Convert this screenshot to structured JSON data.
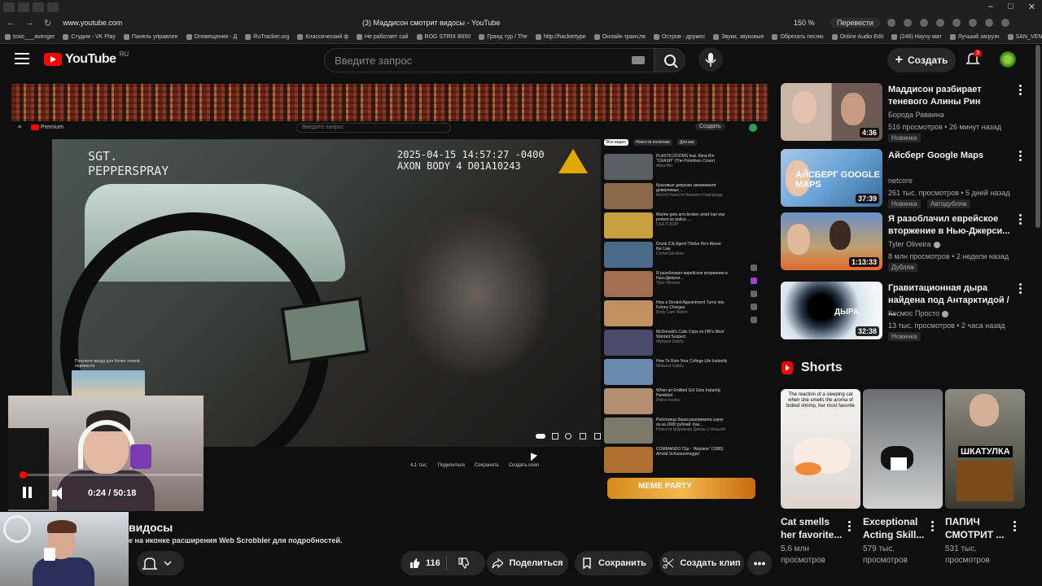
{
  "browser": {
    "tab_title": "(3) Маддисон смотрит видосы - YouTube",
    "url": "www.youtube.com",
    "zoom": "150 %",
    "translate": "Перевести",
    "bookmarks": [
      "toxic___avenger",
      "Студия - VK Play",
      "Панель управлен",
      "Оповещения - Д",
      "RuTracker.org",
      "Классический ф",
      "Не работает сай",
      "ROG STRIX B650",
      "Гранд тур / The",
      "http://hackertype",
      "Онлайн трансля",
      "Остров - дружес",
      "Звуки, звуковые",
      "Обрезать песню",
      "Online Audio Edit",
      "(246) Научу мат",
      "Лучший загрузч",
      "SAN_VENCI"
    ]
  },
  "header": {
    "logo_text": "YouTube",
    "region": "RU",
    "search_placeholder": "Введите запрос",
    "create_label": "Создать",
    "notification_count": "3"
  },
  "player": {
    "cam_tag": [
      "SGT.",
      "PEPPERSPRAY"
    ],
    "cam_timestamp": [
      "2025-04-15 14:57:27 -0400",
      "AXON BODY 4 D01A10243"
    ],
    "inner_premium": "Premium",
    "inner_search": "Введите запрос",
    "inner_create": "Создать",
    "inner_tabs": [
      "Все видео",
      "Новости политики",
      "Для вас"
    ],
    "inner_actions": [
      "4,1 тыс.",
      "Поделиться",
      "Сохранить",
      "Создать клип"
    ],
    "meme_party": "MEME PARTY",
    "pip_caption": "Получите ввода для более точной перевести",
    "time": "0:24 / 50:18",
    "progress": 0.008,
    "mini_videos": [
      {
        "title": "PLASTICZOOMS feat. Alina Rin \"CRASH\" (The Primitives Cover)",
        "meta": "Alina Rin"
      },
      {
        "title": "Красивые девушки заманивали доверчивых ...",
        "meta": "Вести Новости Нижнего Новгорода"
      },
      {
        "title": "Marine gets arm broken amid Iran war protest as police, ...",
        "meta": "USA TODAY"
      },
      {
        "title": "Drunk ICE Agent Thinks He's Above the Law",
        "meta": "CrimeCatchline"
      },
      {
        "title": "Я разоблачил еврейское вторжение в Нью-Джерси...",
        "meta": "Tyler Oliveira"
      },
      {
        "title": "How a Dentist Appointment Turns into Felony Charges",
        "meta": "Body Cam Watch"
      },
      {
        "title": "McDonald's Calls Cops on FBI's Most Wanted Suspect",
        "meta": "Midwest Safety"
      },
      {
        "title": "How To Ruin Your College Life Instantly",
        "meta": "Midwest Safety"
      },
      {
        "title": "When an Entitled Girl Gets Instantly Humbled",
        "meta": "Police Insider"
      },
      {
        "title": "Работница банка разгромила сауну из-за 2000 рублей. Как...",
        "meta": "Новости Шарикова Даешь с пользой"
      },
      {
        "title": "COMMANDO Clip - \"Airplane\" (1985) Arnold Schwarzenegger",
        "meta": ""
      }
    ]
  },
  "below_player": {
    "title": "видосы",
    "extension_note": "е на иконке расширения Web Scrobbler для подробностей.",
    "like_count": "116",
    "share_label": "Поделиться",
    "save_label": "Сохранить",
    "clip_label": "Создать клип"
  },
  "recommendations": [
    {
      "title": "Маддисон разбирает теневого Алины Рин",
      "channel": "Борода Раввина",
      "meta": "516 просмотров • 26 минут назад",
      "duration": "4:36",
      "badge": "Новинка",
      "badge2": ""
    },
    {
      "title": "Айсберг Google Maps",
      "channel": "netcore",
      "meta": "261 тыс. просмотров • 5 дней назад",
      "duration": "37:39",
      "badge": "Новинка",
      "badge2": "Автодубляж"
    },
    {
      "title": "Я разоблачил еврейское вторжение в Нью-Джерси...",
      "channel": "Tyler Oliveira",
      "meta": "8 млн просмотров • 2 недели назад",
      "duration": "1:13:33",
      "badge": "Дубляж",
      "badge2": ""
    },
    {
      "title": "Гравитационная дыра найдена под Антарктидой / ...",
      "channel": "Космос Просто",
      "meta": "13 тыс. просмотров • 2 часа назад",
      "duration": "32:38",
      "badge": "Новинка",
      "badge2": ""
    }
  ],
  "thumb_texts": {
    "iceberg": "АЙСБЕРГ GOOGLE MAPS",
    "hole": "ДЫРА"
  },
  "shorts": {
    "heading": "Shorts",
    "items": [
      {
        "title": "Cat smells her favorite...",
        "views": "5,6 млн просмотров",
        "overlay": "The reaction of a sleeping cat when she smells the aroma of boiled shrimp, her most favorite"
      },
      {
        "title": "Exceptional Acting Skill...",
        "views": "579 тыс. просмотров",
        "overlay": ""
      },
      {
        "title": "ПАПИЧ СМОТРИТ ...",
        "views": "531 тыс. просмотров",
        "overlay": "ШКАТУЛКА"
      }
    ]
  },
  "colors": {
    "accent": "#ff0000",
    "background": "#0f0f0f",
    "pill": "#272727",
    "meme": "#f2b84a"
  }
}
